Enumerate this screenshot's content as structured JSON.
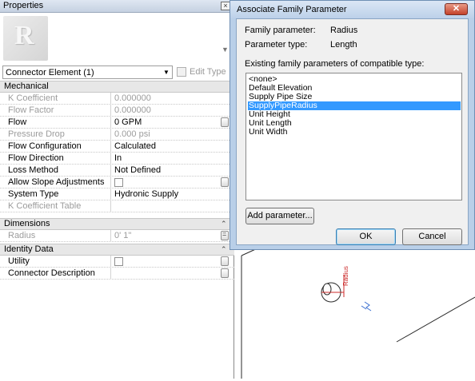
{
  "properties": {
    "title": "Properties",
    "type_selector": "Connector Element (1)",
    "edit_type": "Edit Type",
    "groups": [
      {
        "name": "Mechanical"
      },
      {
        "name": "Dimensions"
      },
      {
        "name": "Identity Data"
      }
    ],
    "rows": [
      {
        "name": "K Coefficient",
        "value": "0.000000"
      },
      {
        "name": "Flow Factor",
        "value": "0.000000"
      },
      {
        "name": "Flow",
        "value": "0 GPM"
      },
      {
        "name": "Pressure Drop",
        "value": "0.000 psi"
      },
      {
        "name": "Flow Configuration",
        "value": "Calculated"
      },
      {
        "name": "Flow Direction",
        "value": "In"
      },
      {
        "name": "Loss Method",
        "value": "Not Defined"
      },
      {
        "name": "Allow Slope Adjustments",
        "value": ""
      },
      {
        "name": "System Type",
        "value": "Hydronic Supply"
      },
      {
        "name": "K Coefficient Table",
        "value": ""
      },
      {
        "name": "Radius",
        "value": "0' 1\""
      },
      {
        "name": "Utility",
        "value": ""
      },
      {
        "name": "Connector Description",
        "value": ""
      }
    ]
  },
  "dialog": {
    "title": "Associate Family Parameter",
    "family_parameter_label": "Family parameter:",
    "family_parameter_value": "Radius",
    "parameter_type_label": "Parameter type:",
    "parameter_type_value": "Length",
    "existing_label": "Existing family parameters of compatible type:",
    "list_items": [
      "<none>",
      "Default Elevation",
      "Supply Pipe Size",
      "SupplyPipeRadius",
      "Unit Height",
      "Unit Length",
      "Unit Width"
    ],
    "selected_item": "SupplyPipeRadius",
    "add_parameter": "Add parameter...",
    "ok": "OK",
    "cancel": "Cancel",
    "close_glyph": "✕"
  },
  "view": {
    "connector_label": "Radius",
    "colors": {
      "connector": "#cc2b2b",
      "flow_arrow": "#3a6fd0",
      "model_edges": "#2a2a2a"
    }
  },
  "colors": {
    "selection": "#3399ff",
    "dialog_frame": "#b9cfe8",
    "group_header": "#e7e7e7"
  }
}
